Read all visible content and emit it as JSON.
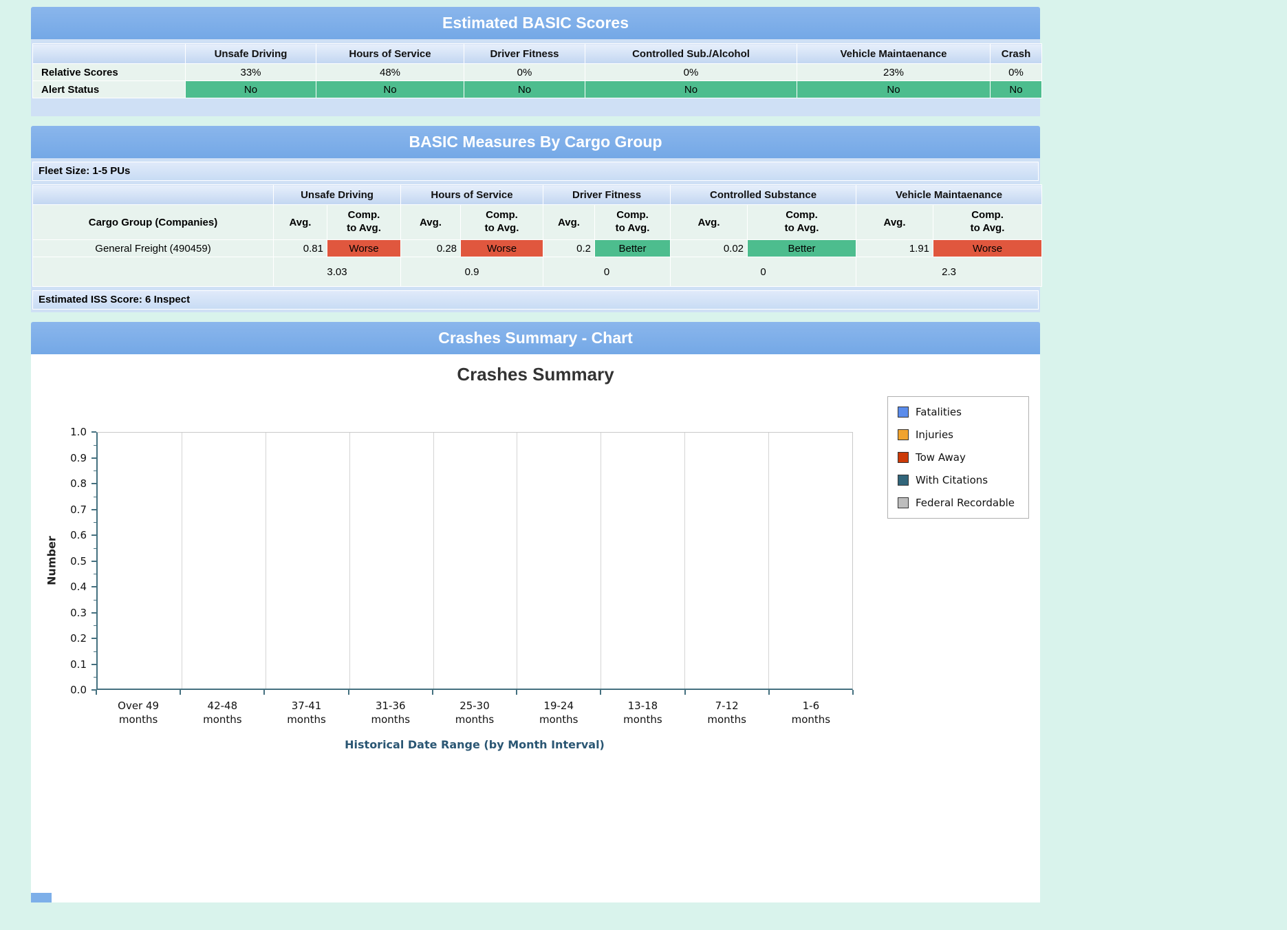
{
  "colors": {
    "banner_blue": "#7dafe9",
    "container_blue": "#cfe0f5",
    "row_green": "#e8f3ee",
    "alert_green": "#4dbd8e",
    "worse_red": "#e0573e",
    "better_green": "#4dbd8e"
  },
  "scores": {
    "title": "Estimated BASIC Scores",
    "columns": [
      "Unsafe Driving",
      "Hours of Service",
      "Driver Fitness",
      "Controlled Sub./Alcohol",
      "Vehicle Maintaenance",
      "Crash"
    ],
    "rows": [
      {
        "label": "Relative Scores",
        "values": [
          "33%",
          "48%",
          "0%",
          "0%",
          "23%",
          "0%"
        ]
      },
      {
        "label": "Alert Status",
        "values": [
          "No",
          "No",
          "No",
          "No",
          "No",
          "No"
        ]
      }
    ]
  },
  "measures": {
    "title": "BASIC Measures By Cargo Group",
    "fleet_size": "Fleet Size: 1-5 PUs",
    "row_header": "Cargo Group (Companies)",
    "groups": [
      "Unsafe Driving",
      "Hours of Service",
      "Driver Fitness",
      "Controlled Substance",
      "Vehicle Maintaenance"
    ],
    "avg_label": "Avg.",
    "comp_label": "Comp.\nto Avg.",
    "company_row": {
      "label": "General Freight (490459)",
      "avgs": [
        "0.81",
        "0.28",
        "0.2",
        "0.02",
        "1.91"
      ],
      "comps": [
        "Worse",
        "Worse",
        "Better",
        "Better",
        "Worse"
      ]
    },
    "group_averages": [
      "3.03",
      "0.9",
      "0",
      "0",
      "2.3"
    ],
    "iss_score": "Estimated ISS Score: 6 Inspect"
  },
  "crashes": {
    "section_title": "Crashes Summary - Chart"
  },
  "chart_data": {
    "type": "bar",
    "title": "Crashes Summary",
    "xlabel": "Historical Date Range (by Month Interval)",
    "ylabel": "Number",
    "ylim": [
      0.0,
      1.0
    ],
    "yticks": [
      "1.0",
      "0.9",
      "0.8",
      "0.7",
      "0.6",
      "0.5",
      "0.4",
      "0.3",
      "0.2",
      "0.1",
      "0.0"
    ],
    "categories": [
      "Over 49\nmonths",
      "42-48\nmonths",
      "37-41\nmonths",
      "31-36\nmonths",
      "25-30\nmonths",
      "19-24\nmonths",
      "13-18\nmonths",
      "7-12\nmonths",
      "1-6\nmonths"
    ],
    "series": [
      {
        "name": "Fatalities",
        "color": "#5b8ceb",
        "values": [
          0,
          0,
          0,
          0,
          0,
          0,
          0,
          0,
          0
        ]
      },
      {
        "name": "Injuries",
        "color": "#f0a32f",
        "values": [
          0,
          0,
          0,
          0,
          0,
          0,
          0,
          0,
          0
        ]
      },
      {
        "name": "Tow Away",
        "color": "#cc3a08",
        "values": [
          0,
          0,
          0,
          0,
          0,
          0,
          0,
          0,
          0
        ]
      },
      {
        "name": "With Citations",
        "color": "#31657a",
        "values": [
          0,
          0,
          0,
          0,
          0,
          0,
          0,
          0,
          0
        ]
      },
      {
        "name": "Federal Recordable",
        "color": "#bdbdbd",
        "values": [
          0,
          0,
          0,
          0,
          0,
          0,
          0,
          0,
          0
        ]
      }
    ],
    "legend_position": "top-right",
    "grid": "vertical"
  }
}
